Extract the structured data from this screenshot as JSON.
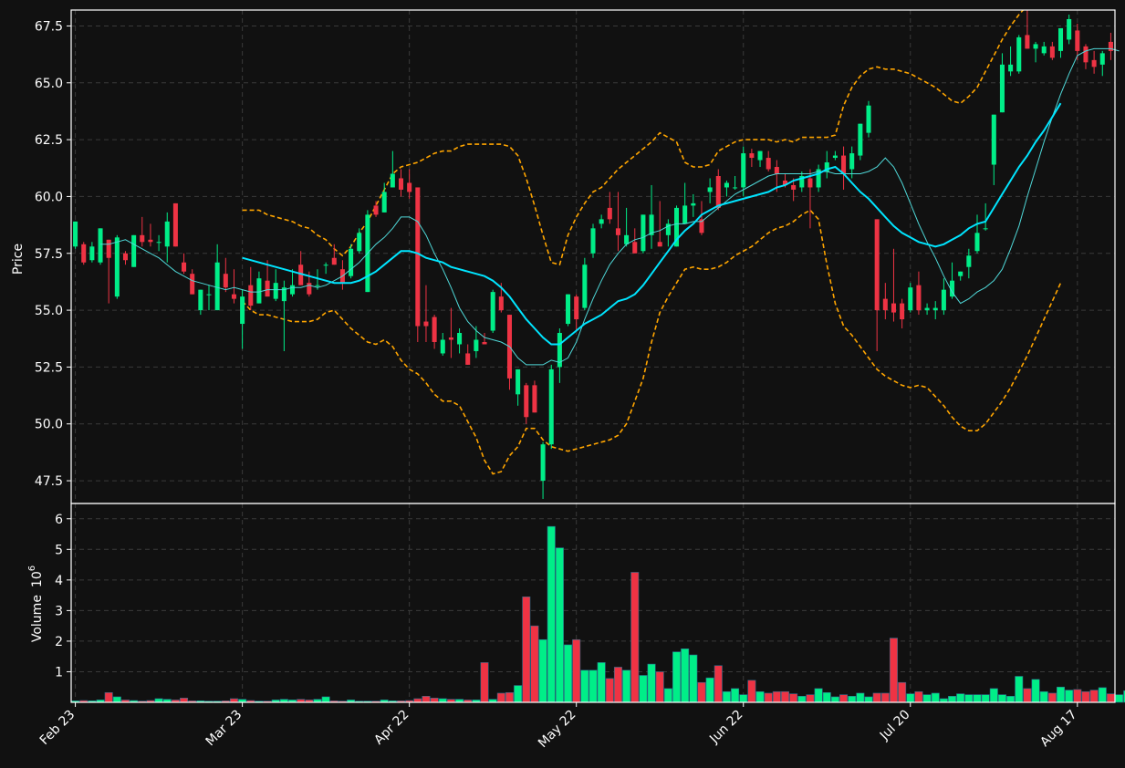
{
  "chart_data": [
    {
      "type": "candlestick",
      "ylabel": "Price",
      "ylim": [
        46.5,
        68.2
      ],
      "y_ticks": [
        47.5,
        50.0,
        52.5,
        55.0,
        57.5,
        60.0,
        62.5,
        65.0,
        67.5
      ],
      "grid": true,
      "up_color": "#00ee88",
      "down_color": "#ee3344",
      "ohlc": [
        [
          57.8,
          58.9,
          57.7,
          58.9
        ],
        [
          57.9,
          58.0,
          57.0,
          57.1
        ],
        [
          57.2,
          58.0,
          57.1,
          57.8
        ],
        [
          57.1,
          58.6,
          57.0,
          58.6
        ],
        [
          58.1,
          58.1,
          55.3,
          57.3
        ],
        [
          55.6,
          58.3,
          55.5,
          58.2
        ],
        [
          57.5,
          57.6,
          57.0,
          57.2
        ],
        [
          56.9,
          58.3,
          56.9,
          58.3
        ],
        [
          58.3,
          59.1,
          57.8,
          58.0
        ],
        [
          58.1,
          58.8,
          57.8,
          58.0
        ],
        [
          58.0,
          58.3,
          57.6,
          58.0
        ],
        [
          57.8,
          59.3,
          57.1,
          58.9
        ],
        [
          59.7,
          59.7,
          57.8,
          57.8
        ],
        [
          57.1,
          57.5,
          56.6,
          56.7
        ],
        [
          56.6,
          56.8,
          55.7,
          55.7
        ],
        [
          55.0,
          55.9,
          54.8,
          55.9
        ],
        [
          55.7,
          56.1,
          55.0,
          55.7
        ],
        [
          55.0,
          57.9,
          55.0,
          57.1
        ],
        [
          56.6,
          57.3,
          55.8,
          56.0
        ],
        [
          55.7,
          56.8,
          55.3,
          55.5
        ],
        [
          54.4,
          55.9,
          53.3,
          55.6
        ],
        [
          56.1,
          56.9,
          55.0,
          55.2
        ],
        [
          55.3,
          56.7,
          55.3,
          56.4
        ],
        [
          56.3,
          57.2,
          55.6,
          55.6
        ],
        [
          55.5,
          56.8,
          55.4,
          56.2
        ],
        [
          55.4,
          56.3,
          53.2,
          56.0
        ],
        [
          55.7,
          56.8,
          55.6,
          56.1
        ],
        [
          57.0,
          57.6,
          56.1,
          56.1
        ],
        [
          56.2,
          56.7,
          55.6,
          55.7
        ],
        [
          56.1,
          56.8,
          55.9,
          56.1
        ],
        [
          57.0,
          57.1,
          56.6,
          57.0
        ],
        [
          57.3,
          57.9,
          57.0,
          57.0
        ],
        [
          56.8,
          57.2,
          55.9,
          56.2
        ],
        [
          56.5,
          57.9,
          56.4,
          57.7
        ],
        [
          57.6,
          58.6,
          57.5,
          58.4
        ],
        [
          55.8,
          59.4,
          55.8,
          59.2
        ],
        [
          59.6,
          59.8,
          59.1,
          59.2
        ],
        [
          59.3,
          60.6,
          59.3,
          60.2
        ],
        [
          60.4,
          62.0,
          60.4,
          61.0
        ],
        [
          60.8,
          61.2,
          60.0,
          60.3
        ],
        [
          60.6,
          61.2,
          59.9,
          60.2
        ],
        [
          60.4,
          60.4,
          53.6,
          54.3
        ],
        [
          54.5,
          56.1,
          53.6,
          54.3
        ],
        [
          54.7,
          54.8,
          53.3,
          53.6
        ],
        [
          53.1,
          54.0,
          53.0,
          53.7
        ],
        [
          53.8,
          55.1,
          52.9,
          53.7
        ],
        [
          53.5,
          54.2,
          53.1,
          54.0
        ],
        [
          53.1,
          53.5,
          52.6,
          52.6
        ],
        [
          53.2,
          54.3,
          52.9,
          53.7
        ],
        [
          53.6,
          54.0,
          53.5,
          53.5
        ],
        [
          54.1,
          55.9,
          54.0,
          55.8
        ],
        [
          55.6,
          56.2,
          54.9,
          55.0
        ],
        [
          54.8,
          54.8,
          51.5,
          52.0
        ],
        [
          51.3,
          52.4,
          50.8,
          52.4
        ],
        [
          51.7,
          51.8,
          50.0,
          50.3
        ],
        [
          51.7,
          51.9,
          50.5,
          50.5
        ],
        [
          47.5,
          49.2,
          46.7,
          49.1
        ],
        [
          49.1,
          52.6,
          48.9,
          52.4
        ],
        [
          52.5,
          54.2,
          51.8,
          54.0
        ],
        [
          54.4,
          55.7,
          54.3,
          55.7
        ],
        [
          55.6,
          55.7,
          54.1,
          54.6
        ],
        [
          55.1,
          57.3,
          55.0,
          57.0
        ],
        [
          57.5,
          58.8,
          57.3,
          58.6
        ],
        [
          58.8,
          59.2,
          58.6,
          59.0
        ],
        [
          59.5,
          60.2,
          58.8,
          59.0
        ],
        [
          58.6,
          60.2,
          57.6,
          58.3
        ],
        [
          57.9,
          59.5,
          57.8,
          58.3
        ],
        [
          58.0,
          58.6,
          57.5,
          57.5
        ],
        [
          57.6,
          59.2,
          57.5,
          59.2
        ],
        [
          58.3,
          60.5,
          57.7,
          59.2
        ],
        [
          58.0,
          59.8,
          57.8,
          57.8
        ],
        [
          58.3,
          59.0,
          57.8,
          58.8
        ],
        [
          57.8,
          59.6,
          57.8,
          59.5
        ],
        [
          58.8,
          60.6,
          58.8,
          59.6
        ],
        [
          59.6,
          60.1,
          59.1,
          59.7
        ],
        [
          59.0,
          59.8,
          58.3,
          58.4
        ],
        [
          60.2,
          60.8,
          59.7,
          60.4
        ],
        [
          60.9,
          61.2,
          59.4,
          59.5
        ],
        [
          60.4,
          60.7,
          60.0,
          60.6
        ],
        [
          60.4,
          60.9,
          60.3,
          60.4
        ],
        [
          60.4,
          62.2,
          60.0,
          61.9
        ],
        [
          61.9,
          62.1,
          61.3,
          61.7
        ],
        [
          61.6,
          62.0,
          61.3,
          62.0
        ],
        [
          61.7,
          62.0,
          61.1,
          61.2
        ],
        [
          61.3,
          61.6,
          60.2,
          61.0
        ],
        [
          60.7,
          61.0,
          60.4,
          60.5
        ],
        [
          60.5,
          60.8,
          59.8,
          60.3
        ],
        [
          60.4,
          61.1,
          60.2,
          60.9
        ],
        [
          60.8,
          61.2,
          58.6,
          60.4
        ],
        [
          60.4,
          61.4,
          60.2,
          61.2
        ],
        [
          61.1,
          62.0,
          60.8,
          61.5
        ],
        [
          61.7,
          62.0,
          61.6,
          61.8
        ],
        [
          61.8,
          62.2,
          60.3,
          61.0
        ],
        [
          61.2,
          62.2,
          60.8,
          61.9
        ],
        [
          61.8,
          63.2,
          61.6,
          63.2
        ],
        [
          62.8,
          64.2,
          62.6,
          64.0
        ],
        [
          59.0,
          59.0,
          53.2,
          55.0
        ],
        [
          55.5,
          56.2,
          54.6,
          55.0
        ],
        [
          55.3,
          57.7,
          54.5,
          54.9
        ],
        [
          55.3,
          55.5,
          54.2,
          54.6
        ],
        [
          55.0,
          56.2,
          54.9,
          56.0
        ],
        [
          56.1,
          56.7,
          54.8,
          55.0
        ],
        [
          55.0,
          55.3,
          54.8,
          55.1
        ],
        [
          55.0,
          55.4,
          54.6,
          55.1
        ],
        [
          55.0,
          56.4,
          54.8,
          55.9
        ],
        [
          55.6,
          57.1,
          55.5,
          56.3
        ],
        [
          56.5,
          56.7,
          56.3,
          56.7
        ],
        [
          56.9,
          57.7,
          56.4,
          57.4
        ],
        [
          57.6,
          59.2,
          57.5,
          58.4
        ],
        [
          58.6,
          59.7,
          58.5,
          58.6
        ],
        [
          61.4,
          63.6,
          60.5,
          63.6
        ],
        [
          63.7,
          66.3,
          63.7,
          65.8
        ],
        [
          65.5,
          66.6,
          65.3,
          65.8
        ],
        [
          65.5,
          67.1,
          65.4,
          67.0
        ],
        [
          67.1,
          68.2,
          66.5,
          66.5
        ],
        [
          66.5,
          66.8,
          65.9,
          66.7
        ],
        [
          66.3,
          66.8,
          66.2,
          66.6
        ],
        [
          66.6,
          66.8,
          66.0,
          66.1
        ],
        [
          66.4,
          67.4,
          66.1,
          67.4
        ],
        [
          66.9,
          68.0,
          66.7,
          67.8
        ],
        [
          67.3,
          67.6,
          66.0,
          66.4
        ],
        [
          66.6,
          66.7,
          65.6,
          65.9
        ],
        [
          66.0,
          66.4,
          65.4,
          65.7
        ],
        [
          65.8,
          66.4,
          65.3,
          66.3
        ],
        [
          66.8,
          67.2,
          66.0,
          66.4
        ]
      ],
      "ma_thin_start": 3,
      "ma_thin": [
        57.9,
        57.9,
        58.0,
        58.1,
        57.9,
        57.7,
        57.5,
        57.3,
        57.0,
        56.7,
        56.5,
        56.3,
        56.2,
        56.1,
        56.0,
        55.9,
        56.0,
        55.9,
        55.8,
        55.8,
        55.9,
        55.9,
        55.9,
        56.0,
        56.0,
        56.1,
        56.0,
        56.1,
        56.3,
        56.5,
        56.8,
        57.1,
        57.5,
        57.9,
        58.2,
        58.6,
        59.1,
        59.1,
        58.9,
        58.3,
        57.5,
        56.8,
        56.0,
        55.1,
        54.5,
        54.1,
        53.8,
        53.7,
        53.6,
        53.4,
        52.9,
        52.6,
        52.6,
        52.6,
        52.8,
        52.7,
        52.9,
        53.6,
        54.6,
        55.5,
        56.3,
        57.0,
        57.5,
        57.9,
        58.1,
        58.2,
        58.4,
        58.5,
        58.7,
        58.8,
        58.8,
        58.9,
        58.9,
        59.2,
        59.5,
        59.8,
        60.1,
        60.3,
        60.5,
        60.7,
        60.9,
        61.0,
        61.0,
        61.0,
        61.0,
        61.0,
        61.1,
        61.1,
        61.0,
        61.0,
        61.0,
        61.0,
        61.1,
        61.3,
        61.7,
        61.3,
        60.6,
        59.7,
        58.8,
        58.0,
        57.3,
        56.5,
        55.8,
        55.3,
        55.5,
        55.8,
        56.0,
        56.3,
        56.8,
        57.7,
        58.7,
        60.0,
        61.2,
        62.4,
        63.5,
        64.5,
        65.4,
        66.2,
        66.4,
        66.5,
        66.5,
        66.5,
        66.4
      ],
      "ma_thick_start": 20,
      "ma_thick": [
        57.3,
        57.2,
        57.1,
        57.0,
        56.9,
        56.8,
        56.7,
        56.6,
        56.5,
        56.4,
        56.3,
        56.2,
        56.2,
        56.2,
        56.3,
        56.5,
        56.7,
        57.0,
        57.3,
        57.6,
        57.6,
        57.5,
        57.3,
        57.2,
        57.1,
        56.9,
        56.8,
        56.7,
        56.6,
        56.5,
        56.3,
        56.0,
        55.6,
        55.1,
        54.6,
        54.2,
        53.8,
        53.5,
        53.5,
        53.8,
        54.1,
        54.4,
        54.6,
        54.8,
        55.1,
        55.4,
        55.5,
        55.7,
        56.1,
        56.6,
        57.1,
        57.6,
        58.1,
        58.5,
        58.8,
        59.2,
        59.4,
        59.6,
        59.7,
        59.8,
        59.9,
        60.0,
        60.1,
        60.2,
        60.4,
        60.5,
        60.7,
        60.8,
        60.9,
        61.0,
        61.2,
        61.3,
        61.0,
        60.6,
        60.2,
        59.9,
        59.5,
        59.1,
        58.7,
        58.4,
        58.2,
        58.0,
        57.9,
        57.8,
        57.9,
        58.1,
        58.3,
        58.6,
        58.8,
        58.9,
        59.5,
        60.1,
        60.7,
        61.3,
        61.8,
        62.4,
        62.9,
        63.5,
        64.1
      ],
      "band_start": 20,
      "band_upper": [
        59.4,
        59.4,
        59.4,
        59.2,
        59.1,
        59.0,
        58.9,
        58.7,
        58.6,
        58.3,
        58.1,
        57.7,
        57.4,
        57.8,
        58.4,
        58.9,
        59.6,
        60.3,
        61.0,
        61.3,
        61.4,
        61.5,
        61.7,
        61.9,
        62.0,
        62.0,
        62.2,
        62.3,
        62.3,
        62.3,
        62.3,
        62.3,
        62.2,
        61.8,
        60.8,
        59.6,
        58.3,
        57.1,
        57.0,
        58.3,
        59.1,
        59.7,
        60.2,
        60.4,
        60.8,
        61.2,
        61.5,
        61.8,
        62.1,
        62.4,
        62.8,
        62.6,
        62.4,
        61.5,
        61.3,
        61.3,
        61.4,
        62.0,
        62.2,
        62.4,
        62.5,
        62.5,
        62.5,
        62.5,
        62.4,
        62.5,
        62.4,
        62.6,
        62.6,
        62.6,
        62.6,
        62.7,
        64.0,
        64.8,
        65.3,
        65.6,
        65.7,
        65.6,
        65.6,
        65.5,
        65.4,
        65.2,
        65.0,
        64.8,
        64.5,
        64.2,
        64.1,
        64.4,
        64.8,
        65.5,
        66.2,
        66.9,
        67.5,
        68.0,
        68.4,
        68.8,
        69.0,
        69.3,
        69.5
      ],
      "band_lower": [
        55.4,
        55.0,
        54.8,
        54.8,
        54.7,
        54.6,
        54.5,
        54.5,
        54.5,
        54.6,
        54.9,
        55.0,
        54.6,
        54.2,
        53.9,
        53.6,
        53.5,
        53.7,
        53.4,
        52.8,
        52.4,
        52.2,
        51.8,
        51.3,
        51.0,
        51.0,
        50.8,
        50.1,
        49.4,
        48.4,
        47.8,
        47.9,
        48.6,
        49.0,
        49.8,
        49.8,
        49.3,
        49.0,
        48.9,
        48.8,
        48.9,
        49.0,
        49.1,
        49.2,
        49.3,
        49.5,
        50.0,
        51.0,
        52.0,
        53.6,
        54.9,
        55.6,
        56.2,
        56.8,
        56.9,
        56.8,
        56.8,
        56.9,
        57.1,
        57.4,
        57.6,
        57.8,
        58.1,
        58.4,
        58.6,
        58.7,
        58.9,
        59.2,
        59.4,
        59.0,
        57.0,
        55.3,
        54.3,
        53.9,
        53.4,
        52.9,
        52.4,
        52.1,
        51.9,
        51.7,
        51.6,
        51.7,
        51.6,
        51.2,
        50.8,
        50.3,
        49.9,
        49.7,
        49.7,
        50.0,
        50.5,
        51.0,
        51.6,
        52.3,
        53.0,
        53.8,
        54.6,
        55.4,
        56.2
      ]
    },
    {
      "type": "bar",
      "ylabel": "Volume",
      "yunit_exponent": "6",
      "ylim": [
        0,
        6.5
      ],
      "y_ticks": [
        1,
        2,
        3,
        4,
        5,
        6
      ],
      "grid": true,
      "values": [
        0.05,
        0.06,
        0.05,
        0.08,
        0.32,
        0.18,
        0.08,
        0.06,
        0.04,
        0.06,
        0.12,
        0.1,
        0.08,
        0.14,
        0.05,
        0.05,
        0.04,
        0.04,
        0.05,
        0.12,
        0.1,
        0.06,
        0.04,
        0.04,
        0.08,
        0.1,
        0.08,
        0.1,
        0.08,
        0.1,
        0.18,
        0.05,
        0.04,
        0.08,
        0.04,
        0.04,
        0.04,
        0.08,
        0.05,
        0.05,
        0.06,
        0.12,
        0.2,
        0.14,
        0.12,
        0.1,
        0.1,
        0.08,
        0.08,
        1.3,
        0.1,
        0.3,
        0.32,
        0.55,
        3.45,
        2.5,
        2.05,
        5.75,
        5.05,
        1.88,
        2.05,
        1.05,
        1.05,
        1.3,
        0.78,
        1.15,
        1.05,
        4.25,
        0.88,
        1.25,
        1.0,
        0.45,
        1.65,
        1.75,
        1.55,
        0.65,
        0.8,
        1.2,
        0.35,
        0.45,
        0.25,
        0.72,
        0.35,
        0.3,
        0.35,
        0.35,
        0.28,
        0.2,
        0.25,
        0.45,
        0.32,
        0.18,
        0.25,
        0.2,
        0.3,
        0.18,
        0.3,
        0.3,
        2.1,
        0.65,
        0.28,
        0.35,
        0.25,
        0.3,
        0.12,
        0.2,
        0.28,
        0.25,
        0.25,
        0.25,
        0.45,
        0.25,
        0.2,
        0.85,
        0.45,
        0.75,
        0.35,
        0.3,
        0.5,
        0.4,
        0.42,
        0.35,
        0.4,
        0.48,
        0.28,
        0.25,
        0.38,
        0.25
      ]
    }
  ],
  "x_axis": {
    "ticks": [
      {
        "label": "Feb 23",
        "index": 0
      },
      {
        "label": "Mar 23",
        "index": 20
      },
      {
        "label": "Apr 22",
        "index": 40
      },
      {
        "label": "May 22",
        "index": 60
      },
      {
        "label": "Jun 22",
        "index": 80
      },
      {
        "label": "Jul 20",
        "index": 100
      },
      {
        "label": "Aug 17",
        "index": 120
      }
    ]
  },
  "colors": {
    "background": "#111111",
    "grid": "#3a3a3a",
    "ma_thin": "#4fd8d8",
    "ma_thick": "#00e5ff",
    "bands": "#ffa500",
    "text": "#ffffff"
  }
}
